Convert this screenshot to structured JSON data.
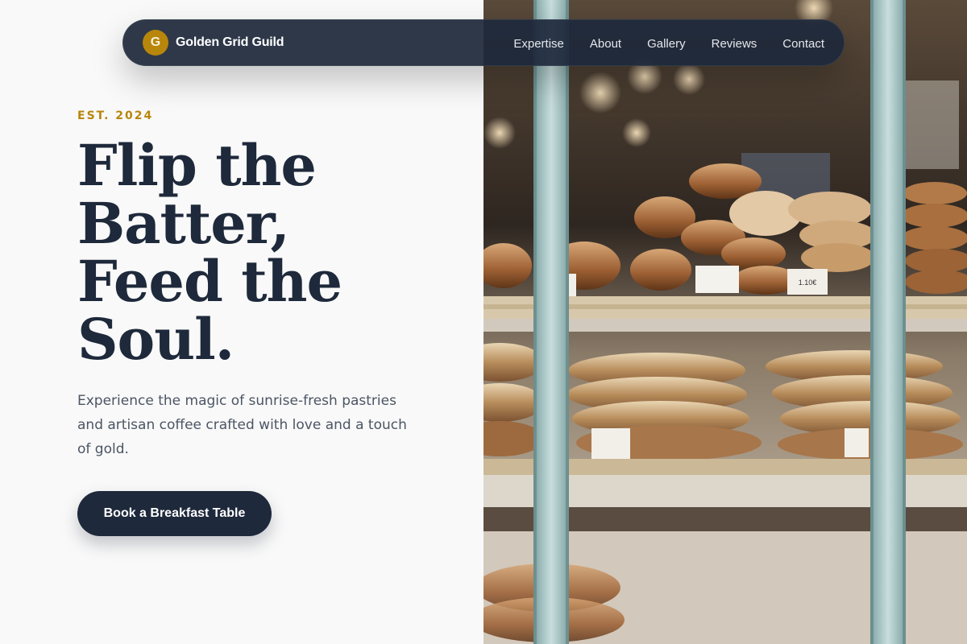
{
  "nav": {
    "brand_initial": "G",
    "brand_name": "Golden Grid Guild",
    "links": [
      "Expertise",
      "About",
      "Gallery",
      "Reviews",
      "Contact"
    ]
  },
  "hero": {
    "eyebrow": "EST. 2024",
    "headline_lines": [
      "Flip the",
      "Batter,",
      "Feed the",
      "Soul."
    ],
    "subtext": "Experience the magic of sunrise-fresh pastries and artisan coffee crafted with love and a touch of gold.",
    "cta_label": "Book a Breakfast Table"
  },
  "photo": {
    "price_tag_1": "",
    "price_tag_2": "1.10€"
  },
  "colors": {
    "navy": "#1e293b",
    "gold": "#b8860b",
    "background": "#f9f9f9"
  }
}
